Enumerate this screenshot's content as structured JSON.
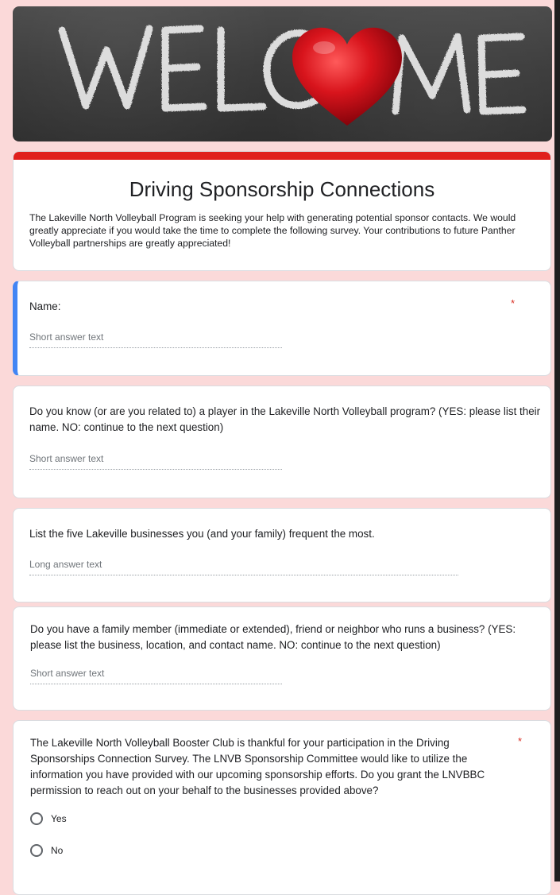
{
  "banner": {
    "word": "WELCOME"
  },
  "form": {
    "title": "Driving Sponsorship Connections",
    "description": "The Lakeville North Volleyball Program is seeking your help with generating potential sponsor contacts. We would greatly appreciate if you would take the time to complete the following survey. Your contributions to future Panther Volleyball partnerships are greatly appreciated!"
  },
  "questions": [
    {
      "title": "Name:",
      "required_mark": "*",
      "answer_placeholder": "Short answer text"
    },
    {
      "title": "Do you know (or are you related to) a player in the Lakeville North Volleyball program? (YES: please list their name. NO: continue to the next question)",
      "answer_placeholder": "Short answer text"
    },
    {
      "title": "List the five Lakeville businesses you (and your family) frequent the most.",
      "answer_placeholder": "Long answer text"
    },
    {
      "title": "Do you have a family member (immediate or extended), friend or neighbor who runs a business? (YES: please list the business, location, and contact name. NO: continue to the next question)",
      "answer_placeholder": "Short answer text"
    },
    {
      "title": "The Lakeville North Volleyball Booster Club is thankful for your participation in the Driving Sponsorships Connection Survey. The LNVB Sponsorship Committee would like to utilize the information you have provided with our upcoming sponsorship efforts. Do you grant the LNVBBC permission to reach out on your behalf to the businesses provided above?",
      "required_mark": "*",
      "options": [
        "Yes",
        "No"
      ]
    }
  ],
  "colors": {
    "page_background": "#fbd9d9",
    "theme_bar": "#e0201d",
    "focus_border": "#4285f4",
    "required": "#d93025"
  }
}
